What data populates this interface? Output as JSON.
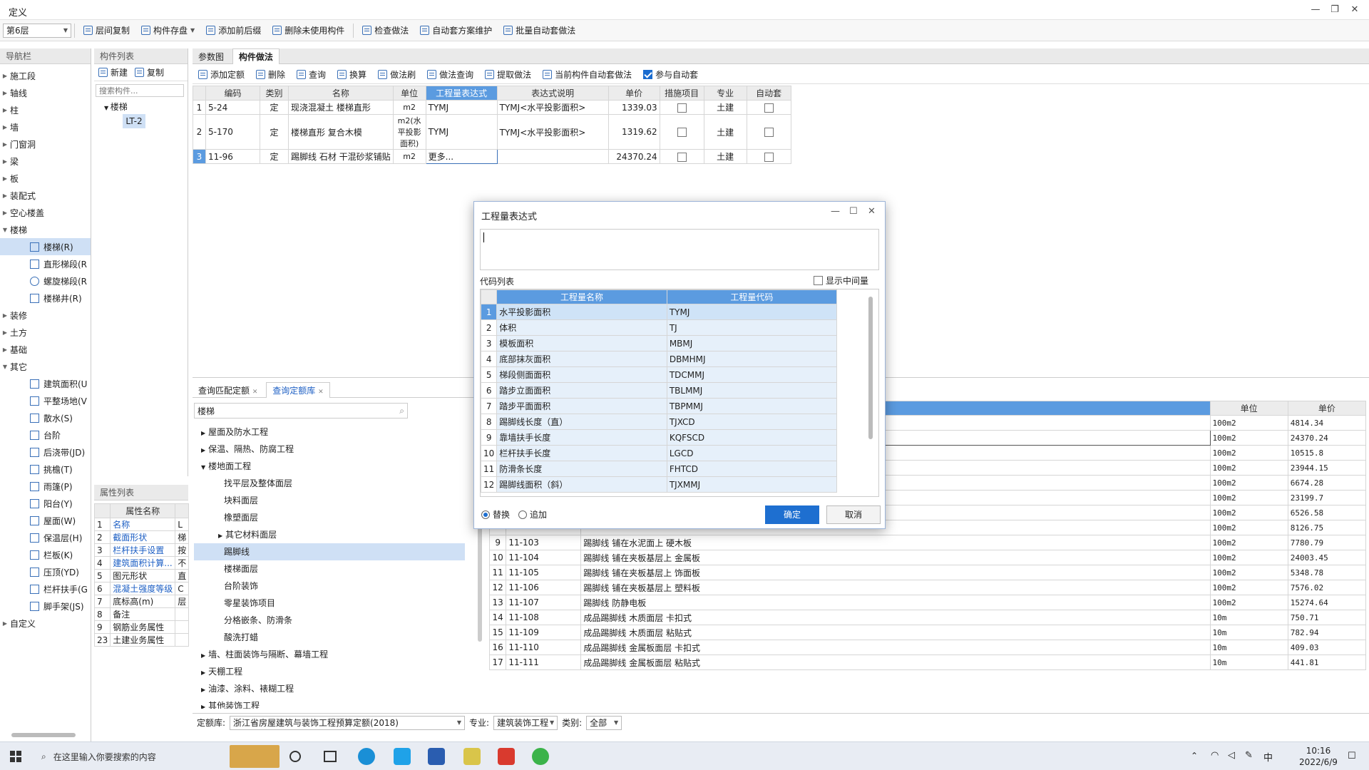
{
  "window": {
    "title": "定义"
  },
  "toolbar": {
    "floor": "第6层",
    "items": [
      "层间复制",
      "构件存盘",
      "添加前后缀",
      "删除未使用构件",
      "检查做法",
      "自动套方案维护",
      "批量自动套做法"
    ]
  },
  "nav": {
    "title": "导航栏",
    "top": [
      "施工段",
      "轴线",
      "柱",
      "墙",
      "门窗洞",
      "梁",
      "板",
      "装配式",
      "空心楼盖",
      "楼梯"
    ],
    "stairs": [
      "楼梯(R)",
      "直形梯段(R",
      "螺旋梯段(R",
      "楼梯井(R)"
    ],
    "mid": [
      "装修",
      "土方",
      "基础",
      "其它"
    ],
    "other": [
      "建筑面积(U",
      "平整场地(V",
      "散水(S)",
      "台阶",
      "后浇带(JD)",
      "挑檐(T)",
      "雨篷(P)",
      "阳台(Y)",
      "屋面(W)",
      "保温层(H)",
      "栏板(K)",
      "压顶(YD)",
      "栏杆扶手(G",
      "脚手架(JS)"
    ],
    "last": "自定义"
  },
  "comp": {
    "title": "构件列表",
    "new": "新建",
    "copy": "复制",
    "search_ph": "搜索构件...",
    "root": "楼梯",
    "child": "LT-2"
  },
  "props": {
    "title": "属性列表",
    "col": "属性名称",
    "rows": [
      {
        "n": "1",
        "name": "名称",
        "v": "L",
        "blue": true
      },
      {
        "n": "2",
        "name": "截面形状",
        "v": "梯",
        "blue": true
      },
      {
        "n": "3",
        "name": "栏杆扶手设置",
        "v": "按",
        "blue": true
      },
      {
        "n": "4",
        "name": "建筑面积计算...",
        "v": "不",
        "blue": true
      },
      {
        "n": "5",
        "name": "图元形状",
        "v": "直",
        "blue": false
      },
      {
        "n": "6",
        "name": "混凝土强度等级",
        "v": "C",
        "blue": true
      },
      {
        "n": "7",
        "name": "底标高(m)",
        "v": "层",
        "blue": false
      },
      {
        "n": "8",
        "name": "备注",
        "v": "",
        "blue": false
      },
      {
        "n": "9",
        "name": "钢筋业务属性",
        "v": "",
        "blue": false
      },
      {
        "n": "23",
        "name": "土建业务属性",
        "v": "",
        "blue": false
      }
    ]
  },
  "tabs": {
    "t1": "参数图",
    "t2": "构件做法"
  },
  "method_toolbar": [
    "添加定额",
    "删除",
    "查询",
    "换算",
    "做法刷",
    "做法查询",
    "提取做法",
    "当前构件自动套做法"
  ],
  "auto_join": "参与自动套",
  "method": {
    "headers": [
      "编码",
      "类别",
      "名称",
      "单位",
      "工程量表达式",
      "表达式说明",
      "单价",
      "措施项目",
      "专业",
      "自动套"
    ],
    "rows": [
      {
        "n": "1",
        "code": "5-24",
        "type": "定",
        "name": "现浇混凝土 楼梯直形",
        "unit": "m2",
        "expr": "TYMJ",
        "desc": "TYMJ<水平投影面积>",
        "price": "1339.03",
        "major": "土建"
      },
      {
        "n": "2",
        "code": "5-170",
        "type": "定",
        "name": "楼梯直形 复合木模",
        "unit": "m2(水平投影面积)",
        "expr": "TYMJ",
        "desc": "TYMJ<水平投影面积>",
        "price": "1319.62",
        "major": "土建"
      },
      {
        "n": "3",
        "code": "11-96",
        "type": "定",
        "name": "踢脚线 石材 干混砂浆铺贴",
        "unit": "m2",
        "expr": "更多...",
        "desc": "",
        "price": "24370.24",
        "major": "土建"
      }
    ]
  },
  "lower_tabs": {
    "t1": "查询匹配定额",
    "t2": "查询定额库"
  },
  "quota_search": "楼梯",
  "quota_tree": {
    "l1": [
      "屋面及防水工程",
      "保温、隔热、防腐工程",
      "楼地面工程"
    ],
    "floor_children": [
      "找平层及整体面层",
      "块料面层",
      "橡塑面层",
      "其它材料面层",
      "踢脚线",
      "楼梯面层",
      "台阶装饰",
      "零星装饰项目",
      "分格嵌条、防滑条",
      "酸洗打蜡"
    ],
    "l1b": [
      "墙、柱面装饰与隔断、幕墙工程",
      "天棚工程",
      "油漆、涂料、裱糊工程",
      "其他装饰工程"
    ]
  },
  "quota_table": {
    "headers": [
      "名称",
      "单位",
      "单价"
    ],
    "top_rows": [
      {
        "unit": "100m2",
        "price": "4814.34"
      },
      {
        "unit": "100m2",
        "price": "24370.24"
      },
      {
        "unit": "100m2",
        "price": "10515.8"
      },
      {
        "unit": "100m2",
        "price": "23944.15"
      },
      {
        "unit": "100m2",
        "price": "6674.28"
      },
      {
        "unit": "100m2",
        "price": "23199.7"
      },
      {
        "unit": "100m2",
        "price": "6526.58"
      },
      {
        "unit": "100m2",
        "price": "8126.75"
      }
    ],
    "rows": [
      {
        "n": "9",
        "code": "11-103",
        "name": "踢脚线 铺在水泥面上 硬木板",
        "unit": "100m2",
        "price": "7780.79"
      },
      {
        "n": "10",
        "code": "11-104",
        "name": "踢脚线 铺在夹板基层上 金属板",
        "unit": "100m2",
        "price": "24003.45"
      },
      {
        "n": "11",
        "code": "11-105",
        "name": "踢脚线 铺在夹板基层上 饰面板",
        "unit": "100m2",
        "price": "5348.78"
      },
      {
        "n": "12",
        "code": "11-106",
        "name": "踢脚线 铺在夹板基层上 塑料板",
        "unit": "100m2",
        "price": "7576.02"
      },
      {
        "n": "13",
        "code": "11-107",
        "name": "踢脚线 防静电板",
        "unit": "100m2",
        "price": "15274.64"
      },
      {
        "n": "14",
        "code": "11-108",
        "name": "成品踢脚线 木质面层 卡扣式",
        "unit": "10m",
        "price": "750.71"
      },
      {
        "n": "15",
        "code": "11-109",
        "name": "成品踢脚线 木质面层 粘贴式",
        "unit": "10m",
        "price": "782.94"
      },
      {
        "n": "16",
        "code": "11-110",
        "name": "成品踢脚线 金属板面层 卡扣式",
        "unit": "10m",
        "price": "409.03"
      },
      {
        "n": "17",
        "code": "11-111",
        "name": "成品踢脚线 金属板面层 粘贴式",
        "unit": "10m",
        "price": "441.81"
      }
    ]
  },
  "footer": {
    "lib_label": "定额库:",
    "lib": "浙江省房屋建筑与装饰工程预算定额(2018)",
    "major_label": "专业:",
    "major": "建筑装饰工程",
    "cat_label": "类别:",
    "cat": "全部"
  },
  "dialog": {
    "title": "工程量表达式",
    "code_list": "代码列表",
    "show_mid": "显示中间量",
    "col_name": "工程量名称",
    "col_code": "工程量代码",
    "rows": [
      {
        "n": "1",
        "name": "水平投影面积",
        "code": "TYMJ"
      },
      {
        "n": "2",
        "name": "体积",
        "code": "TJ"
      },
      {
        "n": "3",
        "name": "模板面积",
        "code": "MBMJ"
      },
      {
        "n": "4",
        "name": "底部抹灰面积",
        "code": "DBMHMJ"
      },
      {
        "n": "5",
        "name": "梯段侧面面积",
        "code": "TDCMMJ"
      },
      {
        "n": "6",
        "name": "踏步立面面积",
        "code": "TBLMMJ"
      },
      {
        "n": "7",
        "name": "踏步平面面积",
        "code": "TBPMMJ"
      },
      {
        "n": "8",
        "name": "踢脚线长度（直）",
        "code": "TJXCD"
      },
      {
        "n": "9",
        "name": "靠墙扶手长度",
        "code": "KQFSCD"
      },
      {
        "n": "10",
        "name": "栏杆扶手长度",
        "code": "LGCD"
      },
      {
        "n": "11",
        "name": "防滑条长度",
        "code": "FHTCD"
      },
      {
        "n": "12",
        "name": "踢脚线面积（斜）",
        "code": "TJXMMJ"
      }
    ],
    "replace": "替换",
    "append": "追加",
    "ok": "确定",
    "cancel": "取消"
  },
  "taskbar": {
    "search": "在这里输入你要搜索的内容",
    "time": "10:16",
    "date": "2022/6/9",
    "ime": "中"
  }
}
